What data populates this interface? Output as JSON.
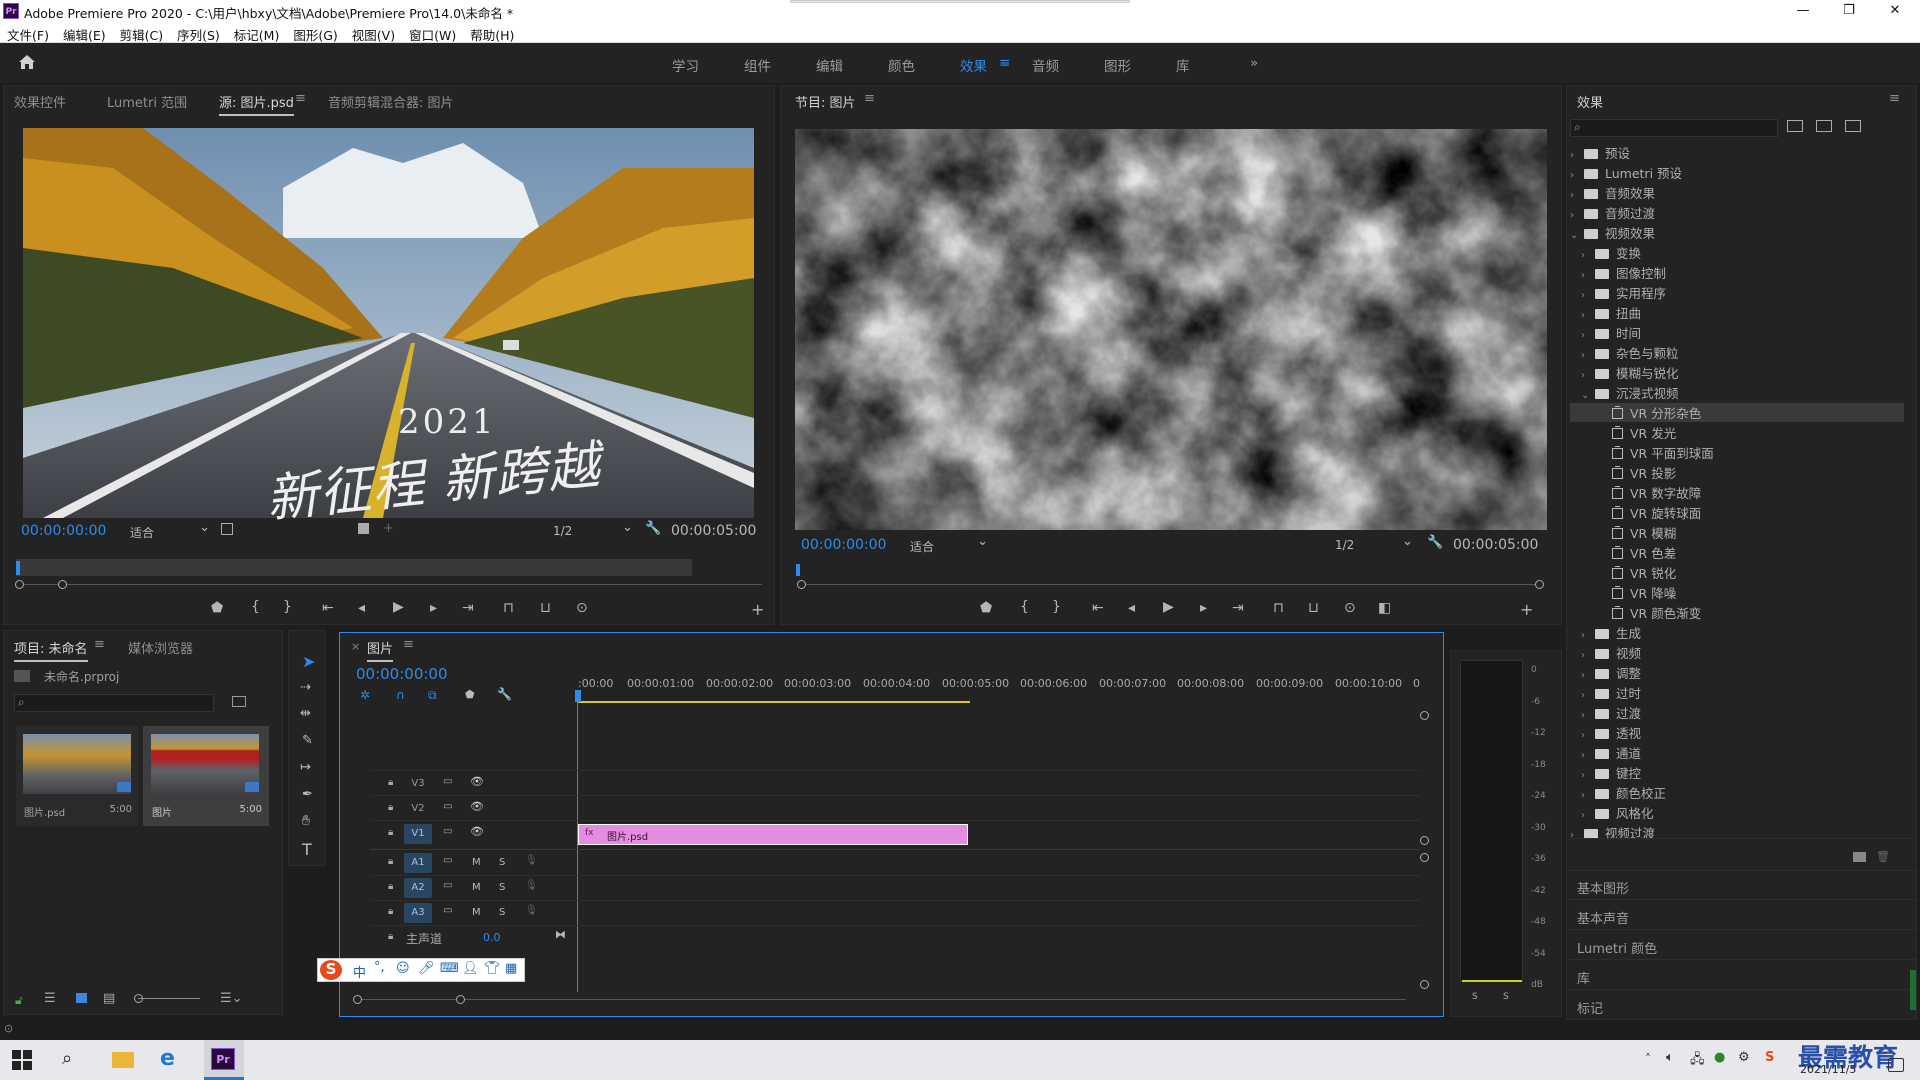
{
  "window": {
    "title": "Adobe Premiere Pro 2020 - C:\\用户\\hbxy\\文档\\Adobe\\Premiere Pro\\14.0\\未命名 *",
    "app_icon": "Pr"
  },
  "menu": [
    "文件(F)",
    "编辑(E)",
    "剪辑(C)",
    "序列(S)",
    "标记(M)",
    "图形(G)",
    "视图(V)",
    "窗口(W)",
    "帮助(H)"
  ],
  "workspaces": [
    "学习",
    "组件",
    "编辑",
    "颜色",
    "效果",
    "音频",
    "图形",
    "库"
  ],
  "active_workspace": "效果",
  "source_panel": {
    "tabs": [
      "效果控件",
      "Lumetri 范围",
      "源: 图片.psd",
      "音频剪辑混合器: 图片"
    ],
    "image_text": {
      "year": "2021",
      "slogan": "新征程 新跨越"
    },
    "timecode": "00:00:00:00",
    "fit": "适合",
    "resolution": "1/2",
    "duration": "00:00:05:00"
  },
  "program_panel": {
    "title": "节目: 图片",
    "timecode": "00:00:00:00",
    "fit": "适合",
    "resolution": "1/2",
    "duration": "00:00:05:00"
  },
  "project_panel": {
    "tabs": [
      "项目: 未命名",
      "媒体浏览器"
    ],
    "project_file": "未命名.prproj",
    "items": [
      {
        "name": "图片.psd",
        "duration": "5:00"
      },
      {
        "name": "图片",
        "duration": "5:00"
      }
    ]
  },
  "timeline": {
    "tab": "图片",
    "timecode": "00:00:00:00",
    "ruler": [
      ":00:00",
      "00:00:01:00",
      "00:00:02:00",
      "00:00:03:00",
      "00:00:04:00",
      "00:00:05:00",
      "00:00:06:00",
      "00:00:07:00",
      "00:00:08:00",
      "00:00:09:00",
      "00:00:10:00",
      "0"
    ],
    "video_tracks": [
      "V3",
      "V2",
      "V1"
    ],
    "audio_tracks": [
      "A1",
      "A2",
      "A3"
    ],
    "master": {
      "label": "主声道",
      "value": "0.0"
    },
    "clip": {
      "name": "图片.psd",
      "color": "#e48ce0"
    },
    "track_buttons": {
      "mute": "M",
      "solo": "S"
    }
  },
  "audio_meter": {
    "scale": [
      "0",
      "-6",
      "-12",
      "-18",
      "-24",
      "-30",
      "-36",
      "-42",
      "-48",
      "-54",
      "dB"
    ],
    "buttons": [
      "S",
      "S"
    ]
  },
  "effects_panel": {
    "title": "效果",
    "tree": [
      {
        "label": "预设",
        "level": 0,
        "type": "folder-star",
        "expanded": false
      },
      {
        "label": "Lumetri 预设",
        "level": 0,
        "type": "folder-star",
        "expanded": false
      },
      {
        "label": "音频效果",
        "level": 0,
        "type": "folder",
        "expanded": false
      },
      {
        "label": "音频过渡",
        "level": 0,
        "type": "folder",
        "expanded": false
      },
      {
        "label": "视频效果",
        "level": 0,
        "type": "folder",
        "expanded": true
      },
      {
        "label": "变换",
        "level": 1,
        "type": "folder",
        "expanded": false
      },
      {
        "label": "图像控制",
        "level": 1,
        "type": "folder",
        "expanded": false
      },
      {
        "label": "实用程序",
        "level": 1,
        "type": "folder",
        "expanded": false
      },
      {
        "label": "扭曲",
        "level": 1,
        "type": "folder",
        "expanded": false
      },
      {
        "label": "时间",
        "level": 1,
        "type": "folder",
        "expanded": false
      },
      {
        "label": "杂色与颗粒",
        "level": 1,
        "type": "folder",
        "expanded": false
      },
      {
        "label": "模糊与锐化",
        "level": 1,
        "type": "folder",
        "expanded": false
      },
      {
        "label": "沉浸式视频",
        "level": 1,
        "type": "folder",
        "expanded": true
      },
      {
        "label": "VR 分形杂色",
        "level": 2,
        "type": "effect",
        "selected": true
      },
      {
        "label": "VR 发光",
        "level": 2,
        "type": "effect"
      },
      {
        "label": "VR 平面到球面",
        "level": 2,
        "type": "effect"
      },
      {
        "label": "VR 投影",
        "level": 2,
        "type": "effect"
      },
      {
        "label": "VR 数字故障",
        "level": 2,
        "type": "effect"
      },
      {
        "label": "VR 旋转球面",
        "level": 2,
        "type": "effect"
      },
      {
        "label": "VR 模糊",
        "level": 2,
        "type": "effect"
      },
      {
        "label": "VR 色差",
        "level": 2,
        "type": "effect"
      },
      {
        "label": "VR 锐化",
        "level": 2,
        "type": "effect"
      },
      {
        "label": "VR 降噪",
        "level": 2,
        "type": "effect"
      },
      {
        "label": "VR 颜色渐变",
        "level": 2,
        "type": "effect"
      },
      {
        "label": "生成",
        "level": 1,
        "type": "folder",
        "expanded": false
      },
      {
        "label": "视频",
        "level": 1,
        "type": "folder",
        "expanded": false
      },
      {
        "label": "调整",
        "level": 1,
        "type": "folder",
        "expanded": false
      },
      {
        "label": "过时",
        "level": 1,
        "type": "folder",
        "expanded": false
      },
      {
        "label": "过渡",
        "level": 1,
        "type": "folder",
        "expanded": false
      },
      {
        "label": "透视",
        "level": 1,
        "type": "folder",
        "expanded": false
      },
      {
        "label": "通道",
        "level": 1,
        "type": "folder",
        "expanded": false
      },
      {
        "label": "键控",
        "level": 1,
        "type": "folder",
        "expanded": false
      },
      {
        "label": "颜色校正",
        "level": 1,
        "type": "folder",
        "expanded": false
      },
      {
        "label": "风格化",
        "level": 1,
        "type": "folder",
        "expanded": false
      },
      {
        "label": "视频过渡",
        "level": 0,
        "type": "folder",
        "expanded": false
      }
    ],
    "bottom_panels": [
      "基本图形",
      "基本声音",
      "Lumetri 颜色",
      "库",
      "标记"
    ]
  },
  "ime_toolbar": {
    "logo": "S",
    "mode": "中"
  },
  "taskbar": {
    "date": "2021/11/5",
    "watermark": "最需教育"
  }
}
